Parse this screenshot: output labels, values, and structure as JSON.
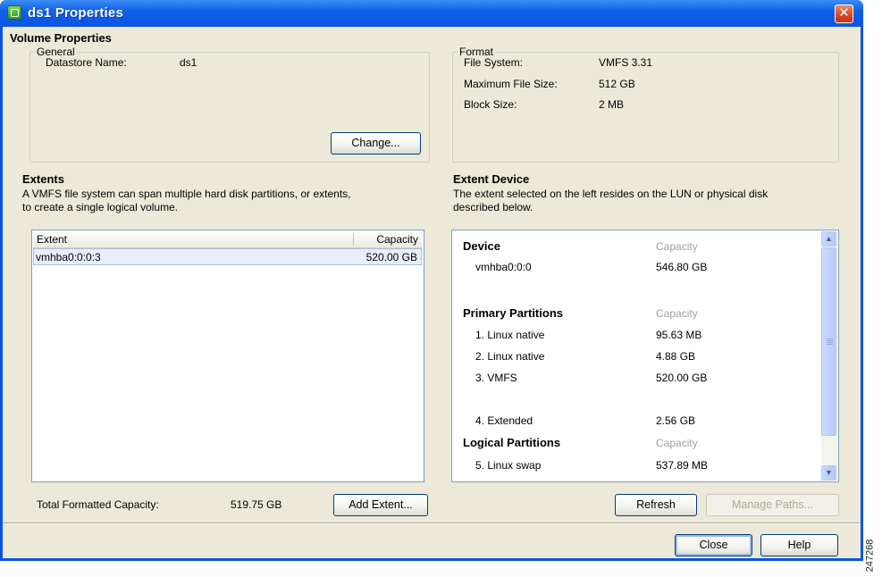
{
  "window": {
    "title": "ds1 Properties"
  },
  "volume_properties": {
    "heading": "Volume Properties",
    "general": {
      "legend": "General",
      "datastore_label": "Datastore Name:",
      "datastore_value": "ds1",
      "change_button": "Change..."
    },
    "format": {
      "legend": "Format",
      "rows": [
        {
          "label": "File System:",
          "value": "VMFS 3.31"
        },
        {
          "label": "Maximum File Size:",
          "value": "512 GB"
        },
        {
          "label": "Block Size:",
          "value": "2 MB"
        }
      ]
    }
  },
  "extents": {
    "heading": "Extents",
    "description_line1": "A VMFS file system can span multiple hard disk partitions, or extents,",
    "description_line2": "to create a single logical volume.",
    "columns": [
      "Extent",
      "Capacity"
    ],
    "rows": [
      {
        "extent": "vmhba0:0:0:3",
        "capacity": "520.00 GB"
      }
    ],
    "total_label": "Total Formatted Capacity:",
    "total_value": "519.75 GB",
    "add_extent_button": "Add Extent..."
  },
  "extent_device": {
    "heading": "Extent Device",
    "description_line1": "The extent selected on the left resides on the LUN or physical disk",
    "description_line2": "described below.",
    "device_header": "Device",
    "capacity_header": "Capacity",
    "device_name": "vmhba0:0:0",
    "device_capacity": "546.80 GB",
    "primary_header": "Primary Partitions",
    "primary_capacity_header": "Capacity",
    "primary_partitions": [
      {
        "name": "1. Linux native",
        "capacity": "95.63 MB"
      },
      {
        "name": "2. Linux native",
        "capacity": "4.88 GB"
      },
      {
        "name": "3. VMFS",
        "capacity": "520.00 GB"
      },
      {
        "name": "4. Extended",
        "capacity": "2.56 GB"
      }
    ],
    "logical_header": "Logical Partitions",
    "logical_capacity_header": "Capacity",
    "logical_partitions": [
      {
        "name": "5. Linux swap",
        "capacity": "537.89 MB"
      }
    ],
    "refresh_button": "Refresh",
    "manage_paths_button": "Manage Paths..."
  },
  "footer": {
    "close_button": "Close",
    "help_button": "Help"
  },
  "figure_number": "247268",
  "colors": {
    "title_bar": "#0a54e4",
    "dialog_bg": "#ece9d8",
    "close_button": "#d8431c"
  }
}
